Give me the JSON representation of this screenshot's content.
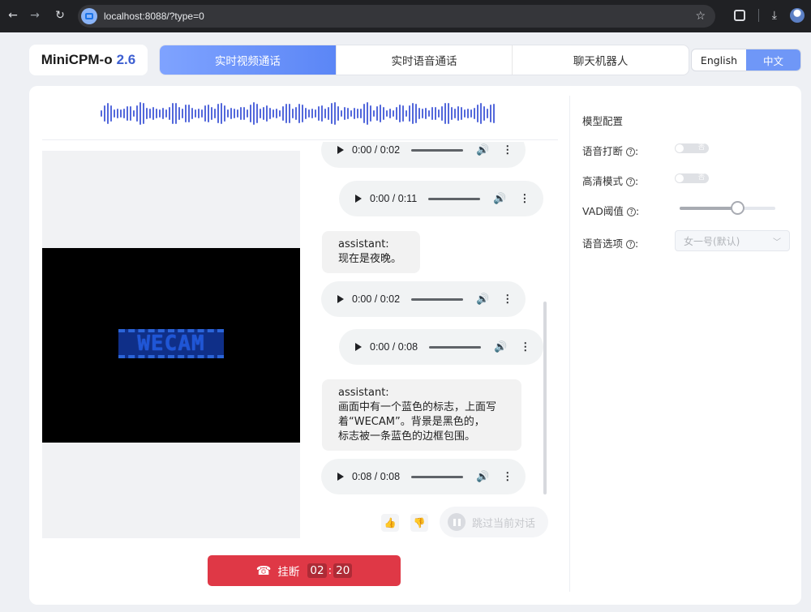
{
  "browser": {
    "url": "localhost:8088/?type=0",
    "icons": [
      "back-icon",
      "forward-icon",
      "reload-icon",
      "star-icon",
      "extensions-icon",
      "download-icon",
      "profile-icon"
    ]
  },
  "header": {
    "logo": "MiniCPM-o",
    "version": "2.6",
    "tabs": [
      {
        "label": "实时视频通话",
        "active": true
      },
      {
        "label": "实时语音通话",
        "active": false
      },
      {
        "label": "聊天机器人",
        "active": false
      }
    ],
    "lang": {
      "english": "English",
      "chinese": "中文",
      "selected": "中文"
    }
  },
  "video": {
    "logo_text": "WECAM"
  },
  "chat": {
    "messages": [
      {
        "type": "audio",
        "time": "0:00 / 0:02",
        "align": "left"
      },
      {
        "type": "audio",
        "time": "0:00 / 0:11",
        "align": "right"
      },
      {
        "type": "text",
        "role": "assistant:",
        "text": "现在是夜晚。"
      },
      {
        "type": "audio",
        "time": "0:00 / 0:02",
        "align": "left"
      },
      {
        "type": "audio",
        "time": "0:00 / 0:08",
        "align": "right"
      },
      {
        "type": "text",
        "role": "assistant:",
        "lines": [
          "画面中有一个蓝色的标志，上面写",
          "着“WECAM”。背景是黑色的，",
          "标志被一条蓝色的边框包围。"
        ]
      },
      {
        "type": "audio",
        "time": "0:08 / 0:08",
        "align": "left"
      }
    ],
    "skip_label": "跳过当前对话"
  },
  "call": {
    "hangup_label": "挂断",
    "minutes": "02",
    "seconds": "20",
    "color": "#df3846"
  },
  "config": {
    "title": "模型配置",
    "voice_interrupt": {
      "label": "语音打断",
      "value": false,
      "switch_text": "否"
    },
    "hd_mode": {
      "label": "高清模式",
      "value": false,
      "switch_text": "否"
    },
    "vad": {
      "label": "VAD阈值",
      "value": 0.6
    },
    "voice_option": {
      "label": "语音选项",
      "value": "女一号(默认)"
    }
  },
  "colors": {
    "accent": "#5b86f6",
    "wave": "#5368db",
    "wecam": "#1f56d6"
  }
}
